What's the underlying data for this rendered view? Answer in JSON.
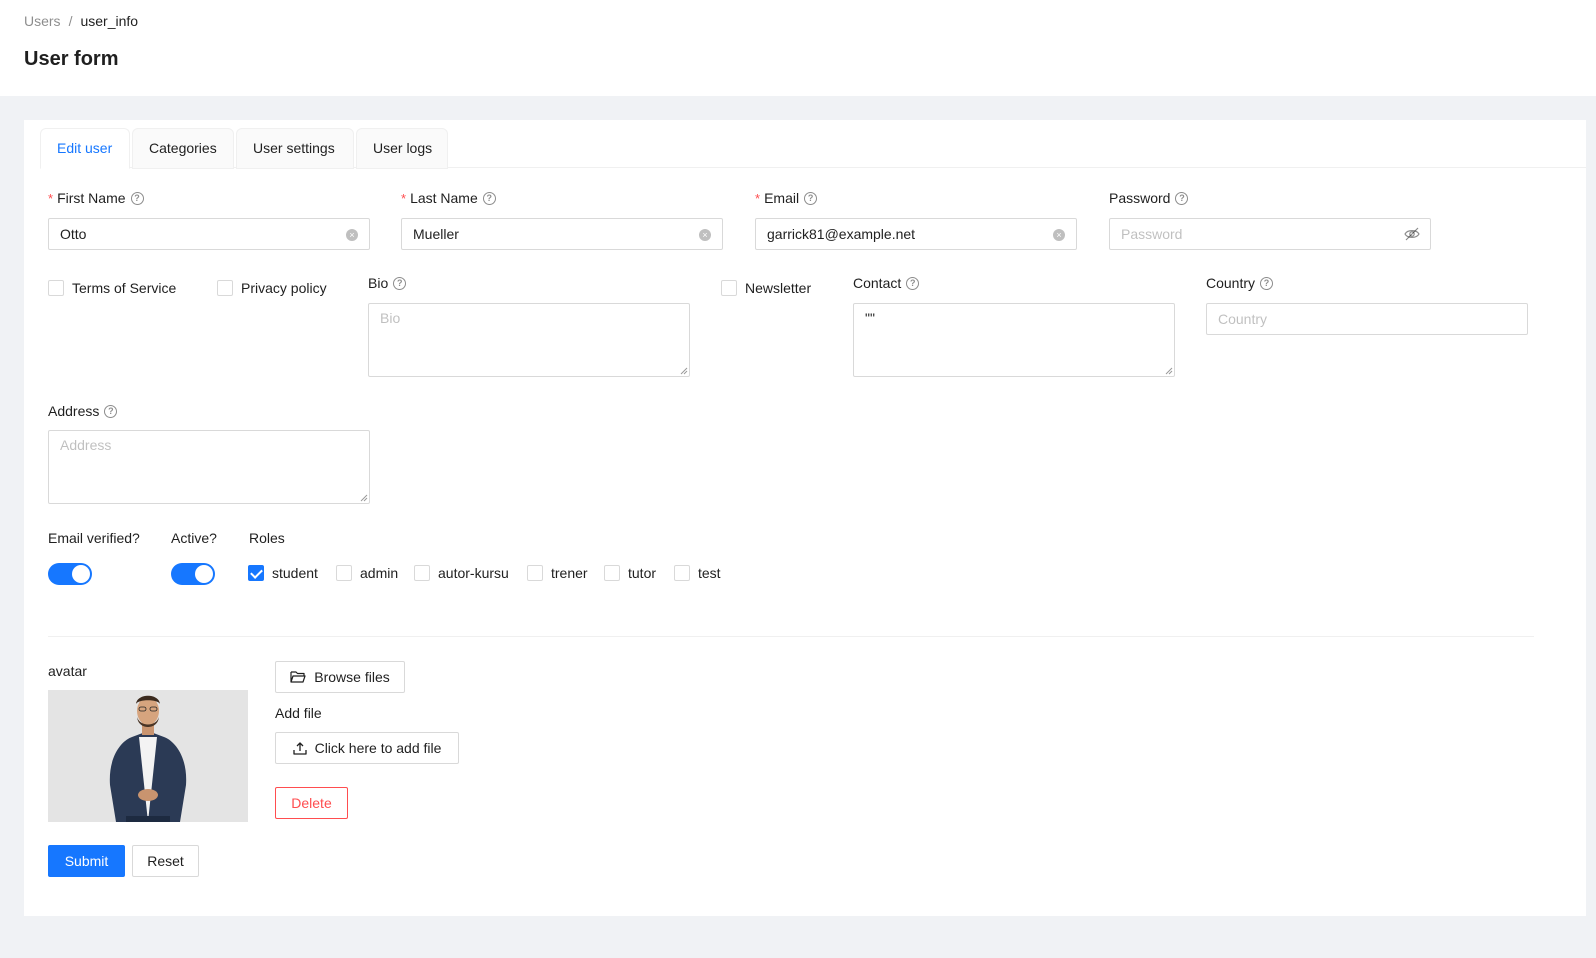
{
  "breadcrumb": {
    "parent": "Users",
    "separator": "/",
    "current": "user_info"
  },
  "page": {
    "title": "User form"
  },
  "tabs": [
    {
      "label": "Edit user",
      "active": true
    },
    {
      "label": "Categories",
      "active": false
    },
    {
      "label": "User settings",
      "active": false
    },
    {
      "label": "User logs",
      "active": false
    }
  ],
  "form": {
    "first_name": {
      "label": "First Name",
      "value": "Otto",
      "required": true
    },
    "last_name": {
      "label": "Last Name",
      "value": "Mueller",
      "required": true
    },
    "email": {
      "label": "Email",
      "value": "garrick81@example.net",
      "required": true
    },
    "password": {
      "label": "Password",
      "placeholder": "Password"
    },
    "terms": {
      "label": "Terms of Service",
      "checked": false
    },
    "privacy": {
      "label": "Privacy policy",
      "checked": false
    },
    "bio": {
      "label": "Bio",
      "placeholder": "Bio"
    },
    "newsletter": {
      "label": "Newsletter",
      "checked": false
    },
    "contact": {
      "label": "Contact",
      "value": "\"\""
    },
    "country": {
      "label": "Country",
      "placeholder": "Country"
    },
    "address": {
      "label": "Address",
      "placeholder": "Address"
    },
    "email_verified": {
      "label": "Email verified?",
      "on": true
    },
    "active": {
      "label": "Active?",
      "on": true
    },
    "roles": {
      "label": "Roles",
      "options": [
        {
          "label": "student",
          "checked": true
        },
        {
          "label": "admin",
          "checked": false
        },
        {
          "label": "autor-kursu",
          "checked": false
        },
        {
          "label": "trener",
          "checked": false
        },
        {
          "label": "tutor",
          "checked": false
        },
        {
          "label": "test",
          "checked": false
        }
      ]
    },
    "avatar": {
      "label": "avatar",
      "browse_label": "Browse files",
      "add_file_label": "Add file",
      "click_add_label": "Click here to add file",
      "delete_label": "Delete"
    },
    "submit_label": "Submit",
    "reset_label": "Reset"
  },
  "colors": {
    "primary": "#1677ff",
    "danger": "#ff4d4f",
    "background": "#f0f2f5"
  },
  "icons": [
    "help-circle-icon",
    "clear-icon",
    "eye-invisible-icon",
    "folder-open-icon",
    "upload-icon",
    "check-icon"
  ]
}
